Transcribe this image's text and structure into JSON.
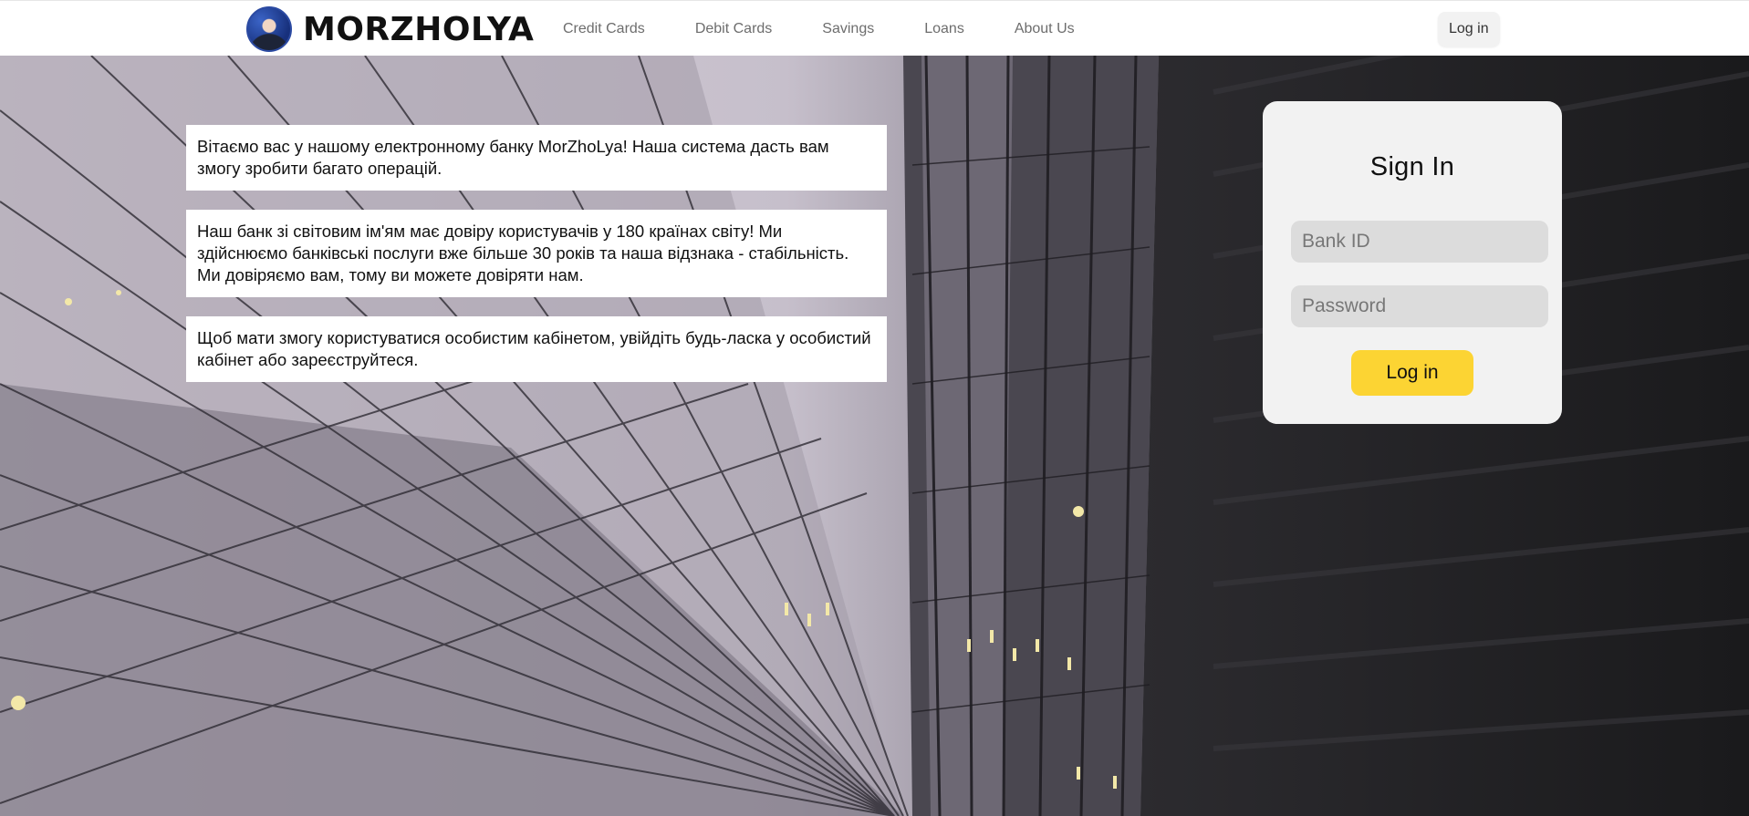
{
  "brand": {
    "name": "MORZHOLYA"
  },
  "nav": {
    "items": [
      "Credit Cards",
      "Debit Cards",
      "Savings",
      "Loans",
      "About Us"
    ]
  },
  "header": {
    "login_label": "Log in"
  },
  "info": {
    "paragraph1": "Вітаємо вас у нашому електронному банку MorZhoLya! Наша система дасть вам змогу зробити багато операцій.",
    "paragraph2": "Наш банк зі світовим ім'ям має довіру користувачів у 180 країнах світу! Ми здійснюємо банківські послуги вже більше 30 років та наша відзнака - стабільність. Ми довіряємо вам, тому ви можете довіряти нам.",
    "paragraph3": "Щоб мати змогу користуватися особистим кабінетом, увійдіть будь-ласка у особистий кабінет або зареєструйтеся."
  },
  "signin": {
    "title": "Sign In",
    "bank_id_placeholder": "Bank ID",
    "password_placeholder": "Password",
    "submit_label": "Log in"
  },
  "colors": {
    "accent": "#fcd433",
    "panel": "#f2f2f2",
    "field": "#dcdcdc"
  }
}
